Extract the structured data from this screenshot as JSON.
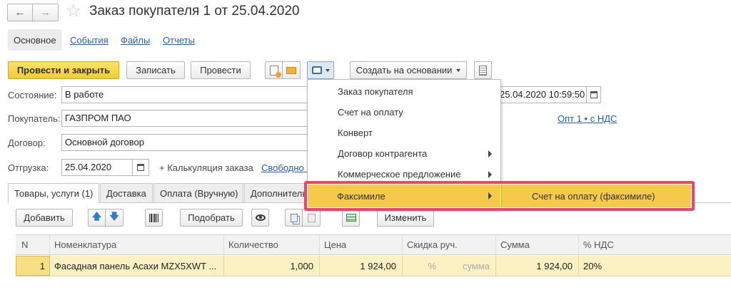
{
  "title": "Заказ покупателя 1 от 25.04.2020",
  "nav_tabs": [
    {
      "label": "Основное"
    },
    {
      "label": "События"
    },
    {
      "label": "Файлы"
    },
    {
      "label": "Отчеты"
    }
  ],
  "toolbar": {
    "post_close": "Провести и закрыть",
    "save": "Записать",
    "post": "Провести",
    "create_based": "Создать на основании"
  },
  "form": {
    "state_label": "Состояние:",
    "state_value": "В работе",
    "buyer_label": "Покупатель:",
    "buyer_value": "ГАЗПРОМ ПАО",
    "contract_label": "Договор:",
    "contract_value": "Основной договор",
    "shipment_label": "Отгрузка:",
    "shipment_value": "25.04.2020",
    "calc_link": "+ Калькуляция заказа",
    "free_link": "Свободно о з",
    "datetime_value": "25.04.2020 10:59:50",
    "price_type_link": "Опт 1 • с НДС"
  },
  "inner_tabs": [
    {
      "label": "Товары, услуги (1)"
    },
    {
      "label": "Доставка"
    },
    {
      "label": "Оплата (Вручную)"
    },
    {
      "label": "Дополнитель"
    }
  ],
  "table_toolbar": {
    "add": "Добавить",
    "pick": "Подобрать",
    "change": "Изменить"
  },
  "table": {
    "columns": [
      "N",
      "Номенклатура",
      "Количество",
      "Цена",
      "Скидка руч.",
      "Сумма",
      "% НДС"
    ],
    "row": {
      "n": "1",
      "name": "Фасадная панель Асахи MZX5XWT ...",
      "qty": "1,000",
      "price": "1 924,00",
      "disc_pct": "%",
      "disc_sum": "сумма",
      "sum": "1 924,00",
      "vat": "20%"
    }
  },
  "print_menu": {
    "items": [
      {
        "label": "Заказ покупателя"
      },
      {
        "label": "Счет на оплату"
      },
      {
        "label": "Конверт"
      },
      {
        "label": "Договор контрагента"
      },
      {
        "label": "Коммерческое предложение"
      },
      {
        "label": "Факсимиле"
      }
    ],
    "submenu_item": "Счет на оплату (факсимиле)"
  },
  "colors": {
    "primary_button": "#f5d33f",
    "highlight": "#f6c94a",
    "frame": "#e8456b",
    "link": "#2a5ea8",
    "selected_row": "#fbf1c3"
  }
}
